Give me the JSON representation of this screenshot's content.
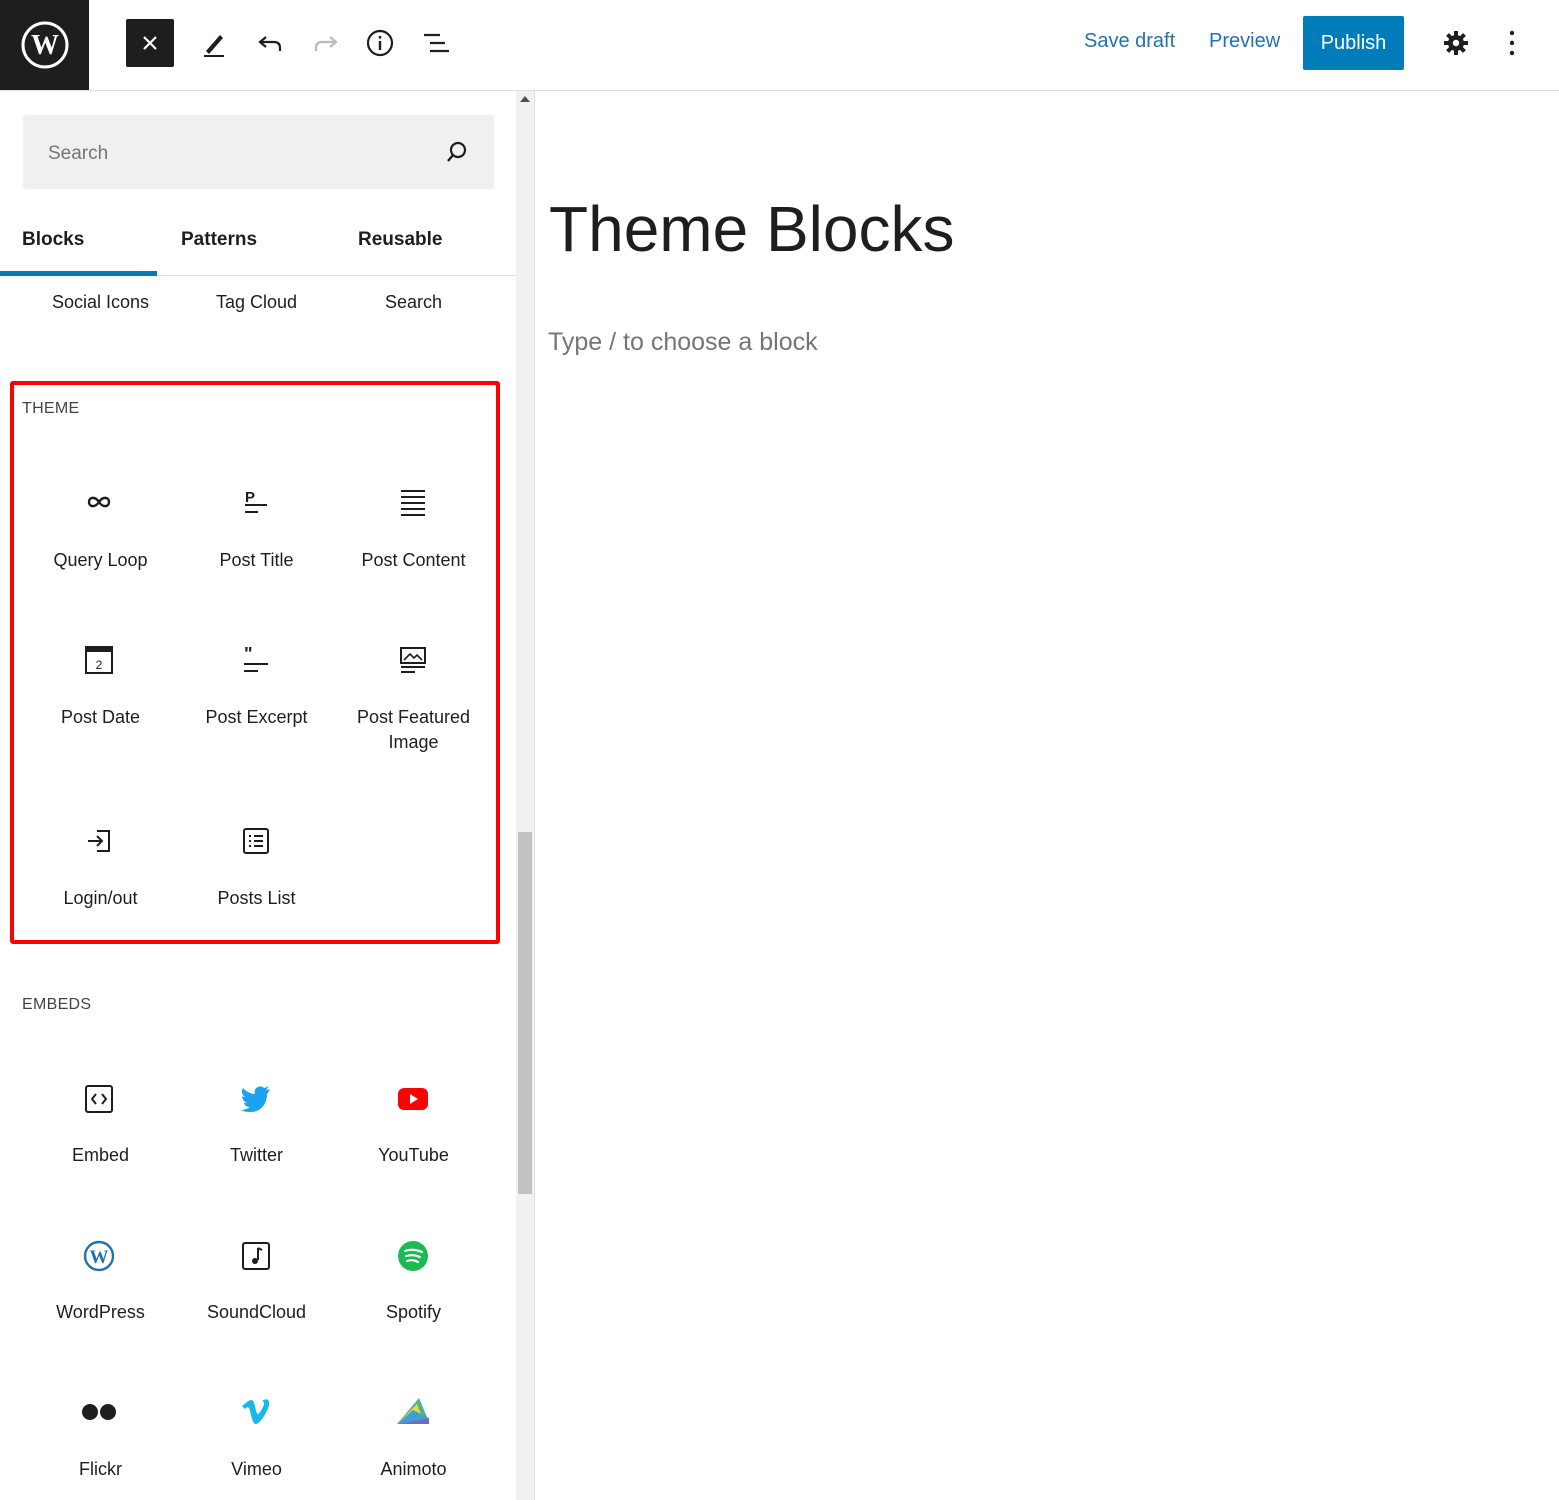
{
  "toolbar": {
    "save_draft": "Save draft",
    "preview": "Preview",
    "publish": "Publish",
    "icons": [
      "wordpress-logo",
      "close",
      "pencil",
      "undo",
      "redo",
      "info",
      "list-view",
      "gear",
      "more-vertical"
    ]
  },
  "sidebar": {
    "search_placeholder": "Search",
    "tabs": [
      "Blocks",
      "Patterns",
      "Reusable"
    ],
    "active_tab": "Blocks",
    "top_row": [
      "Social Icons",
      "Tag Cloud",
      "Search"
    ],
    "theme_title": "THEME",
    "theme_blocks": [
      "Query Loop",
      "Post Title",
      "Post Content",
      "Post Date",
      "Post Excerpt",
      "Post Featured",
      "Image",
      "Login/out",
      "Posts List"
    ],
    "embeds_title": "EMBEDS",
    "embed_blocks": [
      "Embed",
      "Twitter",
      "YouTube",
      "WordPress",
      "SoundCloud",
      "Spotify",
      "Flickr",
      "Vimeo",
      "Animoto"
    ]
  },
  "editor": {
    "title": "Theme Blocks",
    "placeholder": "Type / to choose a block"
  },
  "colors": {
    "accent": "#007cba",
    "link": "#2271b1",
    "highlight": "#ff0000",
    "twitter": "#1da1f2",
    "youtube": "#ff0000",
    "spotify": "#1db954",
    "vimeo": "#1ab7ea"
  }
}
